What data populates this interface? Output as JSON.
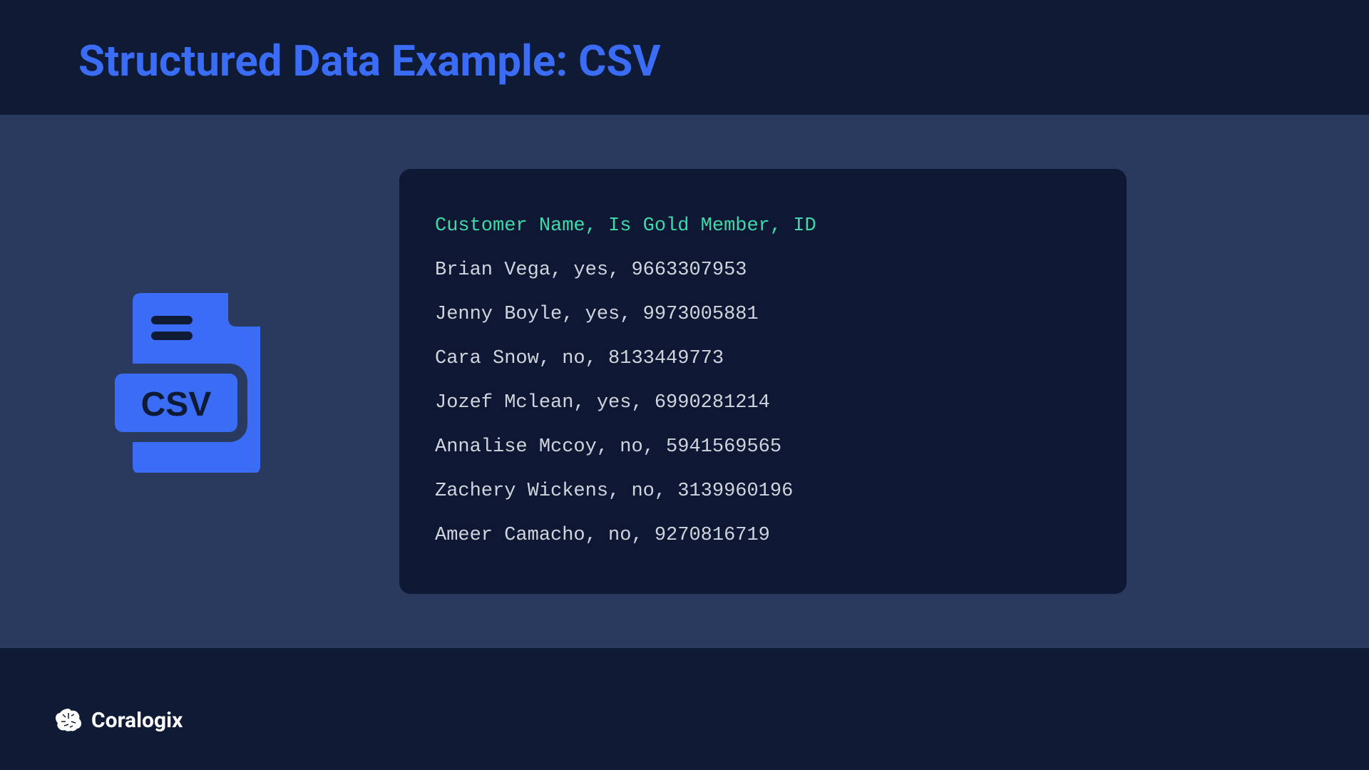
{
  "title": "Structured Data Example: CSV",
  "icon_label": "CSV",
  "csv": {
    "header": "Customer Name, Is Gold Member, ID",
    "rows": [
      "Brian Vega, yes, 9663307953",
      "Jenny Boyle, yes, 9973005881",
      "Cara Snow, no, 8133449773",
      "Jozef Mclean, yes, 6990281214",
      "Annalise Mccoy, no, 5941569565",
      "Zachery Wickens, no, 3139960196",
      "Ameer Camacho, no, 9270816719"
    ]
  },
  "footer": {
    "brand": "Coralogix"
  }
}
